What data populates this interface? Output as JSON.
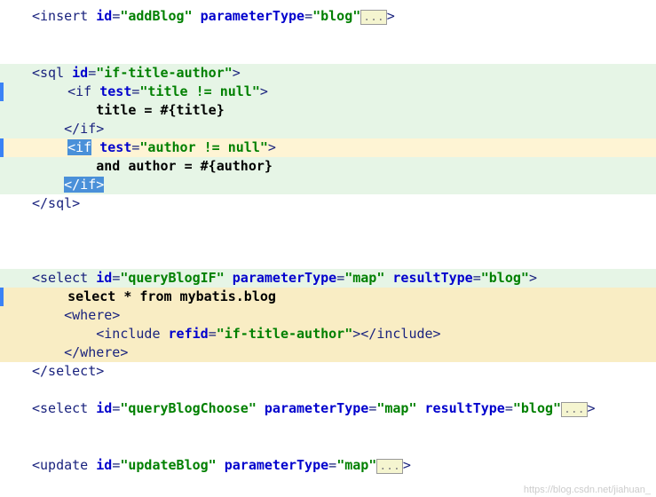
{
  "lines": {
    "l1_open": "<insert",
    "l1_attr1_name": "id",
    "l1_attr1_val": "\"addBlog\"",
    "l1_attr2_name": "parameterType",
    "l1_attr2_val": "\"blog\"",
    "l1_close": ">",
    "fold": "...",
    "l2_open": "<sql",
    "l2_attr1_name": "id",
    "l2_attr1_val": "\"if-title-author\"",
    "l3_open": "<if",
    "l3_attr1_name": "test",
    "l3_attr1_val": "\"title != null\"",
    "l4_text": "title = #{title}",
    "l5_close": "</if>",
    "l6_open": "<if",
    "l6_attr1_name": "test",
    "l6_attr1_val": "\"author != null\"",
    "l7_text": "and author = #{author}",
    "l8_close": "</if>",
    "l9_close": "</sql>",
    "l10_open": "<select",
    "l10_attr1_name": "id",
    "l10_attr1_val": "\"queryBlogIF\"",
    "l10_attr2_name": "parameterType",
    "l10_attr2_val": "\"map\"",
    "l10_attr3_name": "resultType",
    "l10_attr3_val": "\"blog\"",
    "l11_text": "select * from mybatis.blog",
    "l12_open": "<where>",
    "l13_open": "<include",
    "l13_attr1_name": "refid",
    "l13_attr1_val": "\"if-title-author\"",
    "l13_close": "></include>",
    "l14_close": "</where>",
    "l15_close": "</select>",
    "l16_open": "<select",
    "l16_attr1_name": "id",
    "l16_attr1_val": "\"queryBlogChoose\"",
    "l16_attr2_name": "parameterType",
    "l16_attr2_val": "\"map\"",
    "l16_attr3_name": "resultType",
    "l16_attr3_val": "\"blog\"",
    "l17_open": "<update",
    "l17_attr1_name": "id",
    "l17_attr1_val": "\"updateBlog\"",
    "l17_attr2_name": "parameterType",
    "l17_attr2_val": "\"map\""
  },
  "watermark": "https://blog.csdn.net/jiahuan_"
}
